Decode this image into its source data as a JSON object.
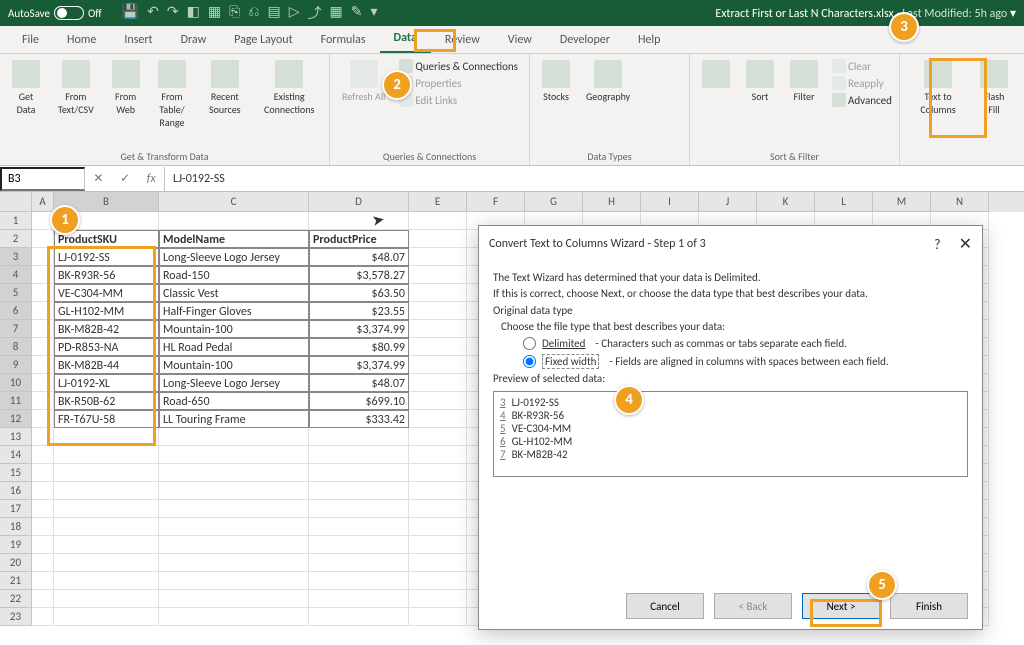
{
  "titlebar": {
    "autosave": "AutoSave",
    "filename": "Extract First or Last N Characters.xlsx",
    "modified": "Last Modified: 5h ago"
  },
  "tabs": [
    "File",
    "Home",
    "Insert",
    "Draw",
    "Page Layout",
    "Formulas",
    "Data",
    "Review",
    "View",
    "Developer",
    "Help"
  ],
  "active_tab": "Data",
  "ribbon": {
    "get_transform": {
      "label": "Get & Transform Data",
      "items": [
        "Get Data",
        "From Text/CSV",
        "From Web",
        "From Table/ Range",
        "Recent Sources",
        "Existing Connections"
      ]
    },
    "queries": {
      "label": "Queries & Connections",
      "refresh": "Refresh All",
      "items": [
        "Queries & Connections",
        "Properties",
        "Edit Links"
      ]
    },
    "datatypes": {
      "label": "Data Types",
      "items": [
        "Stocks",
        "Geography"
      ]
    },
    "sortfilter": {
      "label": "Sort & Filter",
      "sort": "Sort",
      "filter": "Filter",
      "clear": "Clear",
      "reapply": "Reapply",
      "advanced": "Advanced"
    },
    "tools": {
      "t2c": "Text to Columns",
      "flash": "Flash Fill"
    }
  },
  "namebox": "B3",
  "formula": "LJ-0192-SS",
  "columns": [
    {
      "id": "A",
      "w": 22
    },
    {
      "id": "B",
      "w": 105
    },
    {
      "id": "C",
      "w": 150
    },
    {
      "id": "D",
      "w": 100
    },
    {
      "id": "E",
      "w": 58
    },
    {
      "id": "F",
      "w": 58
    },
    {
      "id": "G",
      "w": 58
    },
    {
      "id": "H",
      "w": 58
    },
    {
      "id": "I",
      "w": 58
    },
    {
      "id": "J",
      "w": 58
    },
    {
      "id": "K",
      "w": 58
    },
    {
      "id": "L",
      "w": 58
    },
    {
      "id": "M",
      "w": 58
    },
    {
      "id": "N",
      "w": 58
    }
  ],
  "sheet": {
    "headers": {
      "b": "ProductSKU",
      "c": "ModelName",
      "d": "ProductPrice"
    },
    "rows": [
      {
        "b": "LJ-0192-SS",
        "c": "Long-Sleeve Logo Jersey",
        "d": "$48.07"
      },
      {
        "b": "BK-R93R-56",
        "c": "Road-150",
        "d": "$3,578.27"
      },
      {
        "b": "VE-C304-MM",
        "c": "Classic Vest",
        "d": "$63.50"
      },
      {
        "b": "GL-H102-MM",
        "c": "Half-Finger Gloves",
        "d": "$23.55"
      },
      {
        "b": "BK-M82B-42",
        "c": "Mountain-100",
        "d": "$3,374.99"
      },
      {
        "b": "PD-R853-NA",
        "c": "HL Road Pedal",
        "d": "$80.99"
      },
      {
        "b": "BK-M82B-44",
        "c": "Mountain-100",
        "d": "$3,374.99"
      },
      {
        "b": "LJ-0192-XL",
        "c": "Long-Sleeve Logo Jersey",
        "d": "$48.07"
      },
      {
        "b": "BK-R50B-62",
        "c": "Road-650",
        "d": "$699.10"
      },
      {
        "b": "FR-T67U-58",
        "c": "LL Touring Frame",
        "d": "$333.42"
      }
    ]
  },
  "dialog": {
    "title": "Convert Text to Columns Wizard - Step 1 of 3",
    "line1": "The Text Wizard has determined that your data is Delimited.",
    "line2": "If this is correct, choose Next, or choose the data type that best describes your data.",
    "subhead": "Original data type",
    "choose": "Choose the file type that best describes your data:",
    "delimited": "Delimited",
    "delimited_desc": "Characters such as commas or tabs separate each field.",
    "fixed": "Fixed width",
    "fixed_desc": "Fields are aligned in columns with spaces between each field.",
    "preview_label": "Preview of selected data:",
    "preview": [
      "LJ-0192-SS",
      "BK-R93R-56",
      "VE-C304-MM",
      "GL-H102-MM",
      "BK-M82B-42"
    ],
    "preview_rows": [
      3,
      4,
      5,
      6,
      7
    ],
    "buttons": {
      "cancel": "Cancel",
      "back": "< Back",
      "next": "Next >",
      "finish": "Finish"
    }
  },
  "chart_data": {
    "type": "table",
    "title": "ProductSKU / ModelName / ProductPrice",
    "columns": [
      "ProductSKU",
      "ModelName",
      "ProductPrice"
    ],
    "rows": [
      [
        "LJ-0192-SS",
        "Long-Sleeve Logo Jersey",
        48.07
      ],
      [
        "BK-R93R-56",
        "Road-150",
        3578.27
      ],
      [
        "VE-C304-MM",
        "Classic Vest",
        63.5
      ],
      [
        "GL-H102-MM",
        "Half-Finger Gloves",
        23.55
      ],
      [
        "BK-M82B-42",
        "Mountain-100",
        3374.99
      ],
      [
        "PD-R853-NA",
        "HL Road Pedal",
        80.99
      ],
      [
        "BK-M82B-44",
        "Mountain-100",
        3374.99
      ],
      [
        "LJ-0192-XL",
        "Long-Sleeve Logo Jersey",
        48.07
      ],
      [
        "BK-R50B-62",
        "Road-650",
        699.1
      ],
      [
        "FR-T67U-58",
        "LL Touring Frame",
        333.42
      ]
    ]
  }
}
